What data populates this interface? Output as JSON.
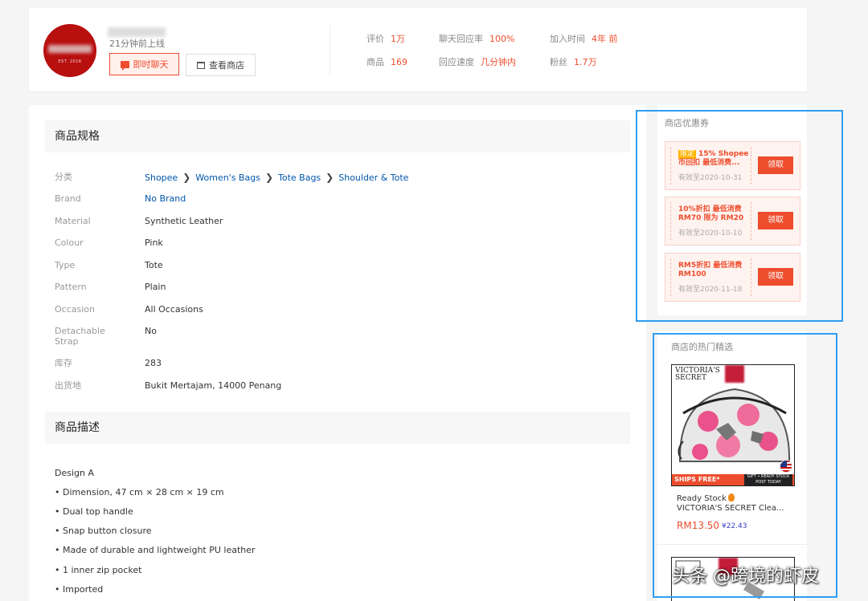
{
  "shop": {
    "est_text": "EST. 2016",
    "online_status": "21分钟前上线",
    "chat_button": "即时聊天",
    "view_shop_button": "查看商店",
    "stats": [
      {
        "label": "评价",
        "value": "1万"
      },
      {
        "label": "聊天回应率",
        "value": "100%"
      },
      {
        "label": "加入时间",
        "value": "4年 前"
      },
      {
        "label": "商品",
        "value": "169"
      },
      {
        "label": "回应速度",
        "value": "几分钟内"
      },
      {
        "label": "粉丝",
        "value": "1.7万"
      }
    ]
  },
  "specs": {
    "title": "商品规格",
    "category_label": "分类",
    "breadcrumb": [
      "Shopee",
      "Women's Bags",
      "Tote Bags",
      "Shoulder & Tote"
    ],
    "rows": [
      {
        "label": "Brand",
        "value": "No Brand"
      },
      {
        "label": "Material",
        "value": "Synthetic Leather"
      },
      {
        "label": "Colour",
        "value": "Pink"
      },
      {
        "label": "Type",
        "value": "Tote"
      },
      {
        "label": "Pattern",
        "value": "Plain"
      },
      {
        "label": "Occasion",
        "value": "All Occasions"
      },
      {
        "label": "Detachable Strap",
        "value": "No"
      },
      {
        "label": "库存",
        "value": "283"
      },
      {
        "label": "出货地",
        "value": "Bukit Mertajam, 14000 Penang"
      }
    ]
  },
  "description": {
    "title": "商品描述",
    "lines": [
      "Design A",
      "•  Dimension, 47 cm × 28 cm × 19 cm",
      "•  Dual top handle",
      "•  Snap button closure",
      "•  Made of durable and lightweight PU leather",
      "•  1 inner zip pocket",
      "•  Imported"
    ]
  },
  "coupons": {
    "title": "商店优惠券",
    "items": [
      {
        "tag": "限定",
        "text": "15% Shopee币回扣 最低消费...",
        "expiry": "有效至2020-10-31",
        "claim": "领取"
      },
      {
        "tag": "",
        "text": "10%折扣 最低消费RM70 限为 RM20",
        "expiry": "有效至2020-10-10",
        "claim": "领取"
      },
      {
        "tag": "",
        "text": "RM5折扣 最低消费RM100",
        "expiry": "有效至2020-11-18",
        "claim": "领取"
      }
    ]
  },
  "hot": {
    "title": "商店的热门精选",
    "product": {
      "brand_logo": "VICTORIA'S SECRET",
      "banner_free": "SHIPS FREE*",
      "banner_stock": "GIFT • READY STOCK POST TODAY",
      "title_line1": "Ready Stock",
      "title_line2": "VICTORIA'S SECRET Clea...",
      "price": "RM13.50",
      "price_cny": "¥22.43"
    }
  },
  "watermark": "头条 @跨境的虾皮",
  "colors": {
    "accent": "#ee4d2d",
    "link": "#0055aa",
    "highlight": "#2e9ef5"
  }
}
